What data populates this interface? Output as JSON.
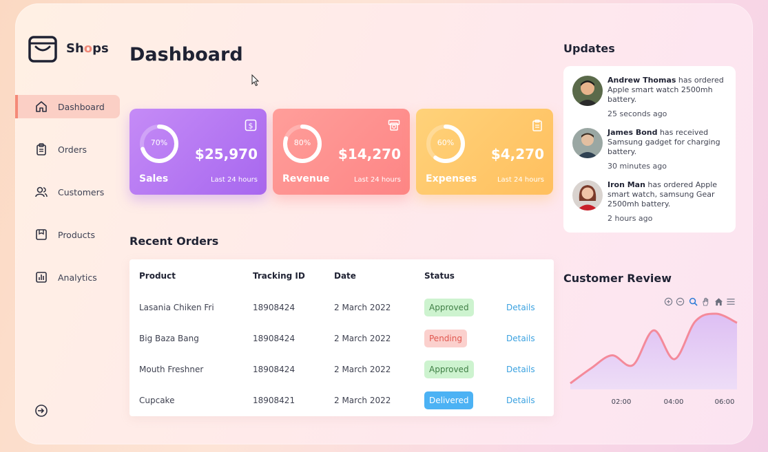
{
  "app": {
    "brand_prefix": "Sh",
    "brand_o": "o",
    "brand_suffix": "ps"
  },
  "sidebar": {
    "items": [
      {
        "label": "Dashboard",
        "icon": "home-icon",
        "active": true
      },
      {
        "label": "Orders",
        "icon": "clipboard-icon"
      },
      {
        "label": "Customers",
        "icon": "users-icon"
      },
      {
        "label": "Products",
        "icon": "box-icon"
      },
      {
        "label": "Analytics",
        "icon": "bar-chart-icon"
      }
    ],
    "logout_icon": "logout-icon"
  },
  "header": {
    "title": "Dashboard"
  },
  "cards": [
    {
      "label": "Sales",
      "amount": "$25,970",
      "percent": "70%",
      "percent_value": 0.7,
      "sub": "Last 24 hours",
      "icon": "dollar-icon",
      "color": "#b378f2"
    },
    {
      "label": "Revenue",
      "amount": "$14,270",
      "percent": "80%",
      "percent_value": 0.8,
      "sub": "Last 24 hours",
      "icon": "cash-icon",
      "color": "#fd8f8c"
    },
    {
      "label": "Expenses",
      "amount": "$4,270",
      "percent": "60%",
      "percent_value": 0.6,
      "sub": "Last 24 hours",
      "icon": "receipt-icon",
      "color": "#ffc96a"
    }
  ],
  "orders": {
    "title": "Recent Orders",
    "columns": [
      "Product",
      "Tracking ID",
      "Date",
      "Status"
    ],
    "rows": [
      {
        "product": "Lasania Chiken Fri",
        "tracking": "18908424",
        "date": "2 March 2022",
        "status": "Approved",
        "link": "Details"
      },
      {
        "product": "Big Baza Bang",
        "tracking": "18908424",
        "date": "2 March 2022",
        "status": "Pending",
        "link": "Details"
      },
      {
        "product": "Mouth Freshner",
        "tracking": "18908424",
        "date": "2 March 2022",
        "status": "Approved",
        "link": "Details"
      },
      {
        "product": "Cupcake",
        "tracking": "18908421",
        "date": "2 March 2022",
        "status": "Delivered",
        "link": "Details"
      }
    ]
  },
  "updates": {
    "title": "Updates",
    "items": [
      {
        "name": "Andrew Thomas",
        "text": " has ordered Apple smart watch 2500mh battery.",
        "time": "25 seconds ago"
      },
      {
        "name": "James Bond",
        "text": " has received Samsung gadget for charging battery.",
        "time": "30 minutes ago"
      },
      {
        "name": "Iron Man",
        "text": " has ordered Apple smart watch, samsung Gear 2500mh battery.",
        "time": "2 hours ago"
      }
    ]
  },
  "review": {
    "title": "Customer Review",
    "tools": [
      "zoom-in-icon",
      "zoom-out-icon",
      "magnify-icon",
      "pan-hand-icon",
      "home-icon",
      "menu-icon"
    ]
  },
  "chart_data": {
    "type": "area",
    "title": "Customer Review",
    "x_tick_labels": [
      "02:00",
      "04:00",
      "06:00"
    ],
    "x": [
      0,
      1,
      2,
      3,
      4,
      5,
      6,
      7,
      8
    ],
    "series": [
      {
        "values": [
          0.08,
          0.28,
          0.45,
          0.32,
          0.78,
          0.4,
          0.9,
          1.0,
          0.88
        ],
        "color": "#f48a9a"
      }
    ],
    "grid": false
  }
}
